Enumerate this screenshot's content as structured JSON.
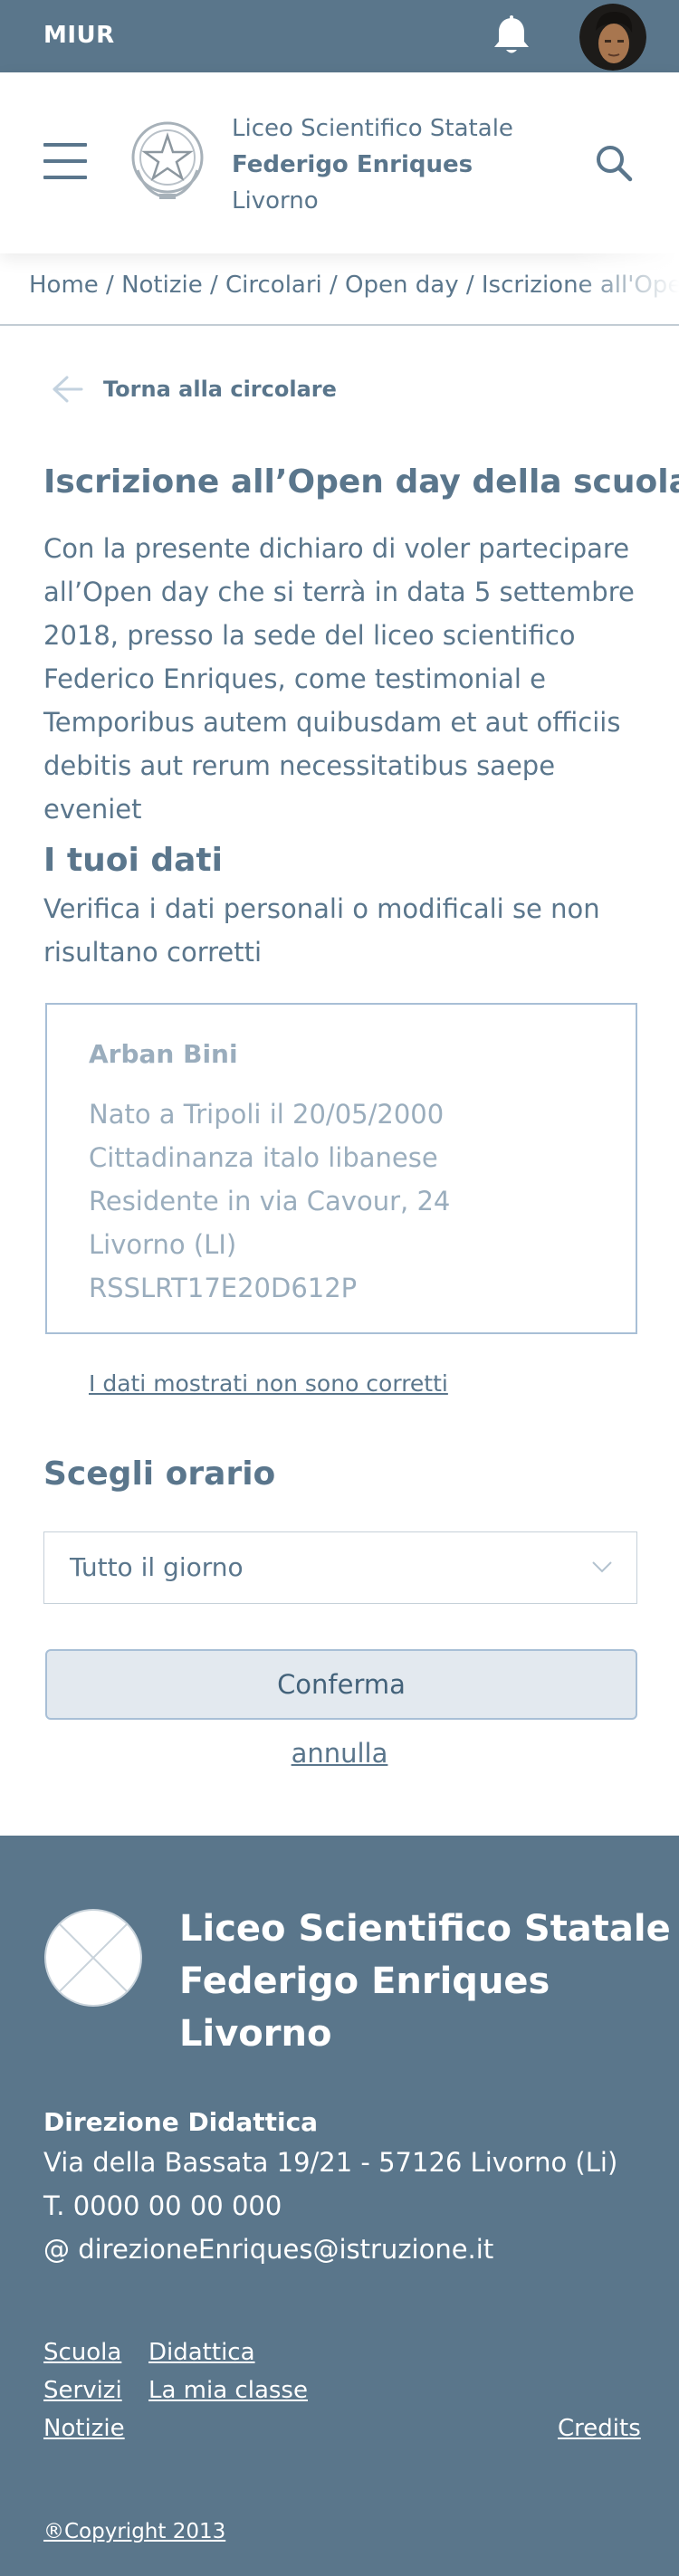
{
  "topbar": {
    "brand": "MIUR"
  },
  "header": {
    "school_line1": "Liceo Scientifico Statale",
    "school_line2": "Federigo Enriques",
    "school_line3": "Livorno"
  },
  "breadcrumb": {
    "trail": "Home / Notizie / Circolari / Open day / Iscrizione all'Open day della scuola"
  },
  "back": {
    "label": "Torna alla circolare"
  },
  "main": {
    "title": "Iscrizione all’Open day della scuola",
    "intro": "Con la presente dichiaro di voler partecipare all’Open day che si terrà in data 5 settembre 2018, presso la sede del liceo scientifico Federico Enriques, come testimonial e Temporibus autem quibusdam et aut officiis debitis aut rerum necessitatibus saepe eveniet"
  },
  "data_section": {
    "heading": "I tuoi dati",
    "subtitle": "Verifica i dati personali o modificali se non risultano corretti",
    "card": {
      "name": "Arban Bini",
      "birth": "Nato a Tripoli il 20/05/2000",
      "citizenship": "Cittadinanza italo libanese",
      "address": "Residente in via Cavour, 24",
      "city": "Livorno (LI)",
      "fiscal_code": "RSSLRT17E20D612P"
    },
    "wrong_link": "I dati mostrati non sono corretti"
  },
  "schedule": {
    "heading": "Scegli orario",
    "selected": "Tutto il giorno"
  },
  "actions": {
    "confirm": "Conferma",
    "cancel": "annulla"
  },
  "footer": {
    "school_line1": "Liceo Scientifico Statale",
    "school_line2": "Federigo Enriques",
    "school_line3": "Livorno",
    "dir_title": "Direzione Didattica",
    "address": "Via della Bassata 19/21 - 57126 Livorno (Li)",
    "phone": "T. 0000 00 00 000",
    "email": "@ direzioneEnriques@istruzione.it",
    "links": {
      "scuola": "Scuola",
      "didattica": "Didattica",
      "servizi": "Servizi",
      "mia_classe": "La mia classe",
      "notizie": "Notizie",
      "credits": "Credits"
    },
    "copyright": "®Copyright 2013"
  },
  "colors": {
    "primary": "#5a768b",
    "text": "#5a768c",
    "muted": "#9aadbd",
    "border": "#a8bfd6",
    "button_bg": "#e3e9ef"
  },
  "icons": [
    "bell-icon",
    "avatar",
    "menu-icon",
    "emblem-icon",
    "search-icon",
    "arrow-left-icon",
    "chevron-down-icon",
    "footer-logo"
  ]
}
